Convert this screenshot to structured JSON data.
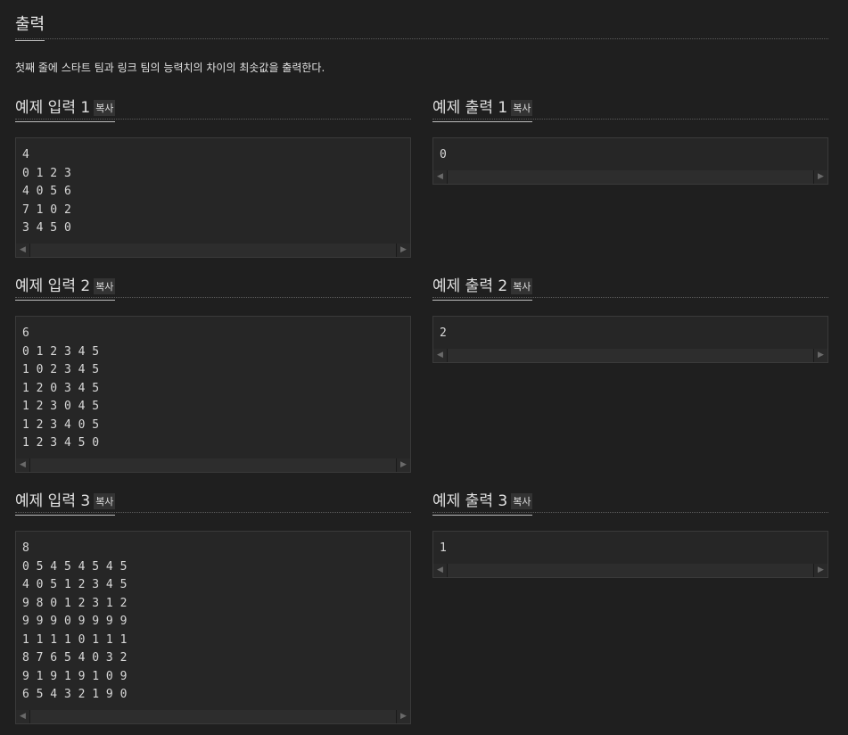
{
  "output_section": {
    "title": "출력",
    "description": "첫째 줄에 스타트 팀과 링크 팀의 능력치의 차이의 최솟값을 출력한다."
  },
  "copy_label": "복사",
  "scroll_left_glyph": "◀",
  "scroll_right_glyph": "▶",
  "samples": [
    {
      "input_title": "예제 입력 1",
      "input": "4\n0 1 2 3\n4 0 5 6\n7 1 0 2\n3 4 5 0",
      "output_title": "예제 출력 1",
      "output": "0"
    },
    {
      "input_title": "예제 입력 2",
      "input": "6\n0 1 2 3 4 5\n1 0 2 3 4 5\n1 2 0 3 4 5\n1 2 3 0 4 5\n1 2 3 4 0 5\n1 2 3 4 5 0",
      "output_title": "예제 출력 2",
      "output": "2"
    },
    {
      "input_title": "예제 입력 3",
      "input": "8\n0 5 4 5 4 5 4 5\n4 0 5 1 2 3 4 5\n9 8 0 1 2 3 1 2\n9 9 9 0 9 9 9 9\n1 1 1 1 0 1 1 1\n8 7 6 5 4 0 3 2\n9 1 9 1 9 1 0 9\n6 5 4 3 2 1 9 0",
      "output_title": "예제 출력 3",
      "output": "1"
    }
  ]
}
